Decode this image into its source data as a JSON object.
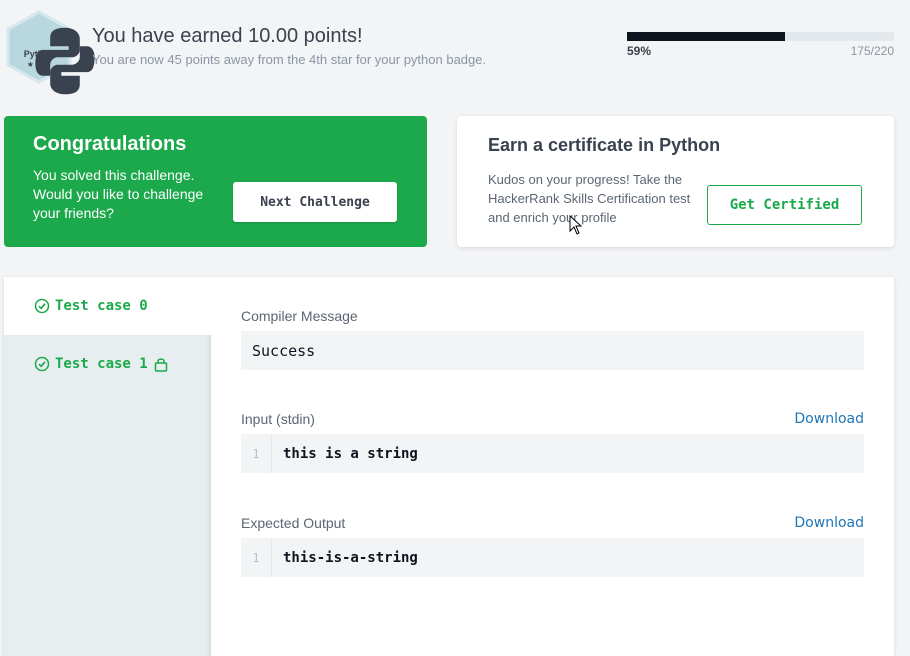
{
  "badge": {
    "language": "Python",
    "stars": "★★★"
  },
  "header": {
    "title": "You have earned 10.00 points!",
    "subtitle": "You are now 45 points away from the 4th star for your python badge.",
    "progress_percent": "59%",
    "progress_value": 0.59,
    "progress_count": "175/220"
  },
  "congrats": {
    "title": "Congratulations",
    "text": "You solved this challenge. Would you like to challenge your friends?",
    "button": "Next Challenge"
  },
  "certificate": {
    "title": "Earn a certificate in Python",
    "text": "Kudos on your progress! Take the HackerRank Skills Certification test and enrich your profile",
    "button": "Get Certified"
  },
  "tabs": [
    {
      "label": "Test case 0",
      "icon": "check-circle-icon"
    },
    {
      "label": "Test case 1",
      "icon": "check-circle-icon",
      "lock": "lock-icon"
    }
  ],
  "results": {
    "compiler_label": "Compiler Message",
    "compiler_message": "Success",
    "input_label": "Input (stdin)",
    "input_download": "Download",
    "input_line_no": "1",
    "input_text": "this is a string",
    "output_label": "Expected Output",
    "output_download": "Download",
    "output_line_no": "1",
    "output_text": "this-is-a-string"
  },
  "colors": {
    "accent": "#1ba94c",
    "dark": "#0e141e",
    "link": "#1f77b4"
  }
}
